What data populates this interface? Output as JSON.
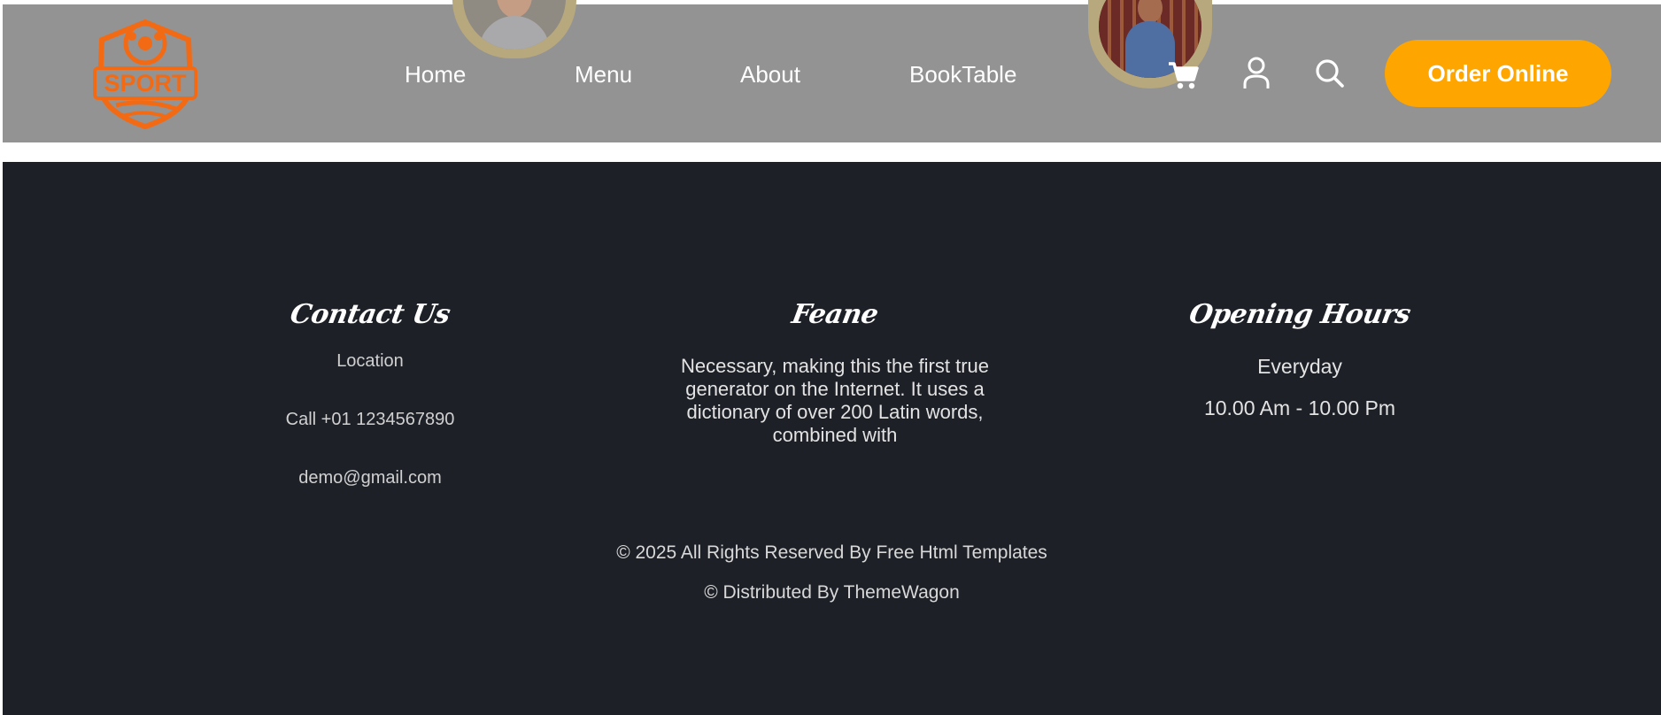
{
  "header": {
    "logo_text": "SPORT",
    "nav": [
      {
        "label": "Home"
      },
      {
        "label": "Menu"
      },
      {
        "label": "About"
      },
      {
        "label": "BookTable"
      }
    ],
    "order_button": "Order Online",
    "icons": [
      "cart-icon",
      "user-icon",
      "search-icon"
    ],
    "colors": {
      "background": "#939393",
      "accent": "#ffa500",
      "logo": "#f26b14"
    }
  },
  "footer": {
    "contact": {
      "title": "Contact Us",
      "location": "Location",
      "phone": "Call +01 1234567890",
      "email": "demo@gmail.com"
    },
    "about": {
      "title": "Feane",
      "text_lines": [
        "Necessary, making this the first true",
        "generator on the Internet. It uses a",
        "dictionary of over 200 Latin words,",
        "combined with"
      ]
    },
    "hours": {
      "title": "Opening Hours",
      "days": "Everyday",
      "time": "10.00 Am - 10.00 Pm"
    },
    "copyright": "© 2025 All Rights Reserved By Free Html Templates",
    "distributed": "© Distributed By ThemeWagon",
    "colors": {
      "background": "#1d2027"
    }
  }
}
